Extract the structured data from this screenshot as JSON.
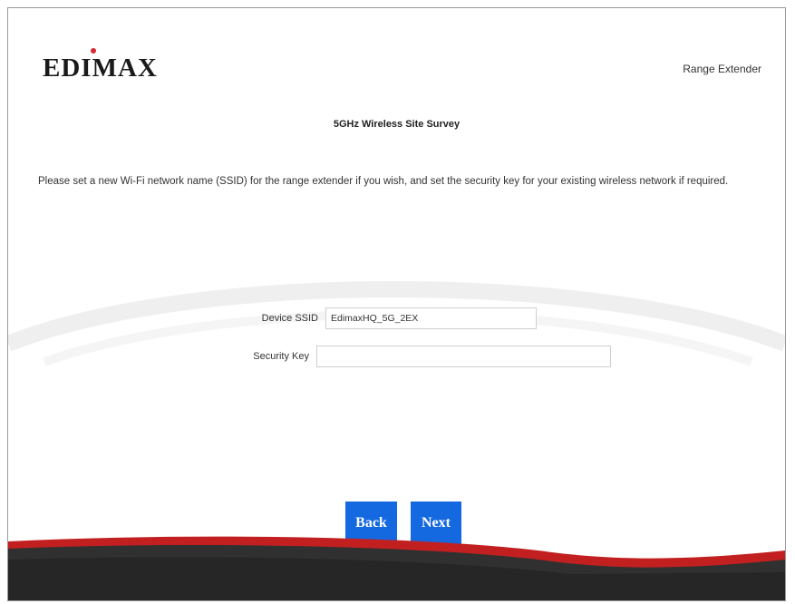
{
  "brand": {
    "logo_text": "EDIMAX",
    "product": "Range Extender"
  },
  "page": {
    "title": "5GHz Wireless Site Survey",
    "description": "Please set a new Wi-Fi network name (SSID) for the range extender if you wish, and set the security key for your existing wireless network if required."
  },
  "form": {
    "ssid_label": "Device SSID",
    "ssid_value": "EdimaxHQ_5G_2EX",
    "key_label": "Security Key",
    "key_value": ""
  },
  "buttons": {
    "back": "Back",
    "next": "Next"
  },
  "colors": {
    "accent": "#1569e0",
    "logo_dot": "#d7282f",
    "footer_dark": "#303030",
    "footer_red": "#8a0f0f"
  }
}
